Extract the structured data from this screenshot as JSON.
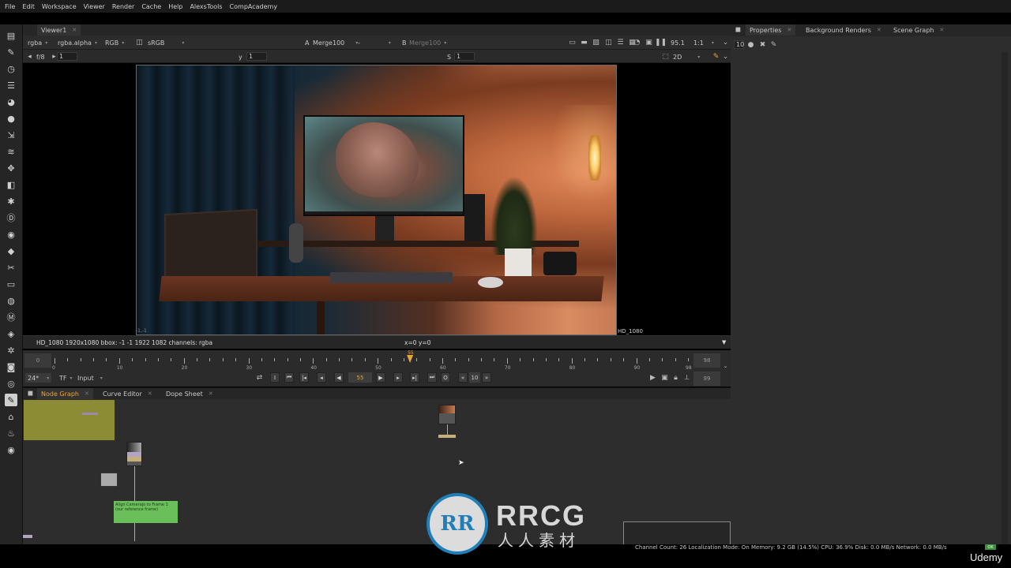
{
  "menu": [
    "File",
    "Edit",
    "Workspace",
    "Viewer",
    "Render",
    "Cache",
    "Help",
    "AlexsTools",
    "CompAcademy"
  ],
  "viewer": {
    "tab_label": "Viewer1",
    "channels": "rgba",
    "alpha_channel": "rgba.alpha",
    "colorspace_mode": "RGB",
    "display_lut": "sRGB",
    "input_a_label": "A",
    "input_a": "Merge100",
    "input_a_op": "-",
    "input_b_label": "B",
    "input_b": "Merge100",
    "zoom": "95.1",
    "proxy_ratio": "1:1",
    "fstop": "f/8",
    "gain_value": "1",
    "y_label": "y",
    "gamma_value": "1",
    "s_label": "S",
    "sat_value": "1",
    "view_mode": "2D",
    "frame_format": "HD_1080",
    "corner_label": "-1,-1",
    "status_info": "HD_1080 1920x1080  bbox: -1 -1 1922 1082 channels: rgba",
    "coords": "x=0 y=0"
  },
  "timeline": {
    "in_frame": "0",
    "out_frame": "98",
    "current_frame": "55",
    "tick_labels": [
      "0",
      "10",
      "20",
      "30",
      "40",
      "50",
      "60",
      "70",
      "80",
      "90",
      "98"
    ],
    "playhead_label": "55",
    "fps": "24*",
    "tf": "TF",
    "input_mode": "Input",
    "increment": "10",
    "end_frame": "99"
  },
  "panels": {
    "bottom_tabs": [
      "Node Graph",
      "Curve Editor",
      "Dope Sheet"
    ],
    "right_tabs": [
      "Properties",
      "Background Renders",
      "Scene Graph"
    ],
    "props_count": "10"
  },
  "nodegraph": {
    "note_line1": "Align Camerajo to Frame 1",
    "note_line2": "(our reference frame)"
  },
  "status_line": "Channel Count: 26  Localization Mode: On  Memory: 9.2 GB (14.5%)  CPU: 36.9%  Disk: 0.0 MB/s  Network: 0.0 MB/s",
  "ok_badge": "OK",
  "watermark": {
    "logo_letters": "RR",
    "title": "RRCG",
    "subtitle": "人人素材"
  },
  "brand": "Udemy",
  "colors": {
    "playhead": "#e8a53a",
    "backdrop": "#8c8c35",
    "note": "#6abf5a",
    "active_tab_text": "#e8a53a"
  }
}
